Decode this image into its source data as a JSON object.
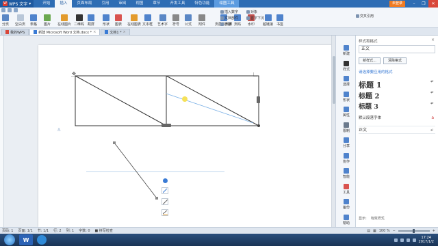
{
  "app": {
    "name": "WPS 文字",
    "login_label": "未登录"
  },
  "menu": [
    {
      "label": "开始",
      "state": "normal"
    },
    {
      "label": "插入",
      "state": "active"
    },
    {
      "label": "页面布局",
      "state": "normal"
    },
    {
      "label": "引用",
      "state": "normal"
    },
    {
      "label": "审阅",
      "state": "normal"
    },
    {
      "label": "视图",
      "state": "normal"
    },
    {
      "label": "章节",
      "state": "normal"
    },
    {
      "label": "开发工具",
      "state": "normal"
    },
    {
      "label": "特色功能",
      "state": "normal"
    },
    {
      "label": "绘图工具",
      "state": "context"
    }
  ],
  "ribbon": {
    "large": [
      {
        "label": "分页",
        "icon": "page-break-icon",
        "color": "#5a87c5"
      },
      {
        "label": "空白页",
        "icon": "blank-page-icon",
        "color": "#b9c7d8"
      },
      {
        "label": "表格",
        "icon": "table-icon",
        "color": "#4f83cc"
      },
      {
        "label": "图片",
        "icon": "picture-icon",
        "color": "#6aa84f"
      },
      {
        "label": "在线图片",
        "icon": "online-picture-icon",
        "color": "#e39b2c"
      },
      {
        "label": "二维码",
        "icon": "qrcode-icon",
        "color": "#333333"
      },
      {
        "label": "截屏",
        "icon": "screenshot-icon",
        "color": "#4f83cc"
      },
      {
        "label": "形状",
        "icon": "shape-icon",
        "color": "#4f83cc"
      },
      {
        "label": "图表",
        "icon": "chart-icon",
        "color": "#d9534f"
      },
      {
        "label": "在线图表",
        "icon": "online-chart-icon",
        "color": "#e39b2c"
      },
      {
        "label": "文本框",
        "icon": "textbox-icon",
        "color": "#4f83cc"
      },
      {
        "label": "艺术字",
        "icon": "wordart-icon",
        "color": "#5a87c5"
      },
      {
        "label": "符号",
        "icon": "symbol-icon",
        "color": "#888888"
      },
      {
        "label": "公式",
        "icon": "formula-icon",
        "color": "#5a87c5"
      },
      {
        "label": "附件",
        "icon": "attachment-icon",
        "color": "#888888"
      },
      {
        "label": "页眉和页脚",
        "icon": "header-footer-icon",
        "color": "#4f83cc"
      },
      {
        "label": "页码",
        "icon": "page-number-icon",
        "color": "#4f83cc"
      },
      {
        "label": "水印",
        "icon": "watermark-icon",
        "color": "#c0504d"
      },
      {
        "label": "超链接",
        "icon": "hyperlink-icon",
        "color": "#4f83cc"
      },
      {
        "label": "书签",
        "icon": "bookmark-icon",
        "color": "#4f83cc"
      }
    ],
    "small": [
      {
        "label": "插入数字",
        "icon": "insert-number-icon"
      },
      {
        "label": "对象",
        "icon": "object-icon"
      },
      {
        "label": "文档部件",
        "icon": "doc-parts-icon"
      },
      {
        "label": "首字下沉",
        "icon": "drop-cap-icon"
      },
      {
        "label": "日期",
        "icon": "date-icon"
      },
      {
        "label": "交叉引用",
        "icon": "cross-reference-icon"
      }
    ]
  },
  "doc_tabs": [
    {
      "label": "我的WPS",
      "active": false
    },
    {
      "label": "新建 Microsoft Word 文档.docx *",
      "active": true
    },
    {
      "label": "文档1 *",
      "active": false
    }
  ],
  "style_pane": {
    "title": "样式和格式",
    "current_style": "正文",
    "new_style_button": "新样式...",
    "clear_format_button": "清除格式",
    "hint": "请选择要应用的格式",
    "items": [
      {
        "label": "标题 1"
      },
      {
        "label": "标题 2"
      },
      {
        "label": "标题 3"
      },
      {
        "label": "默认段落字体"
      },
      {
        "label": "正文"
      }
    ],
    "footer_show_label": "显示:",
    "footer_show_value": "有效样式"
  },
  "side_tools": [
    {
      "label": "新建",
      "icon": "new-icon",
      "color": "#4f83cc"
    },
    {
      "label": "样式",
      "icon": "style-icon",
      "color": "#333333"
    },
    {
      "label": "选择",
      "icon": "select-icon",
      "color": "#4f83cc"
    },
    {
      "label": "形状",
      "icon": "shape-icon",
      "color": "#4f83cc"
    },
    {
      "label": "属性",
      "icon": "property-icon",
      "color": "#4f83cc"
    },
    {
      "label": "限制",
      "icon": "restrict-icon",
      "color": "#6b7a8c"
    },
    {
      "label": "分享",
      "icon": "share-icon",
      "color": "#4f83cc"
    },
    {
      "label": "协作",
      "icon": "collaborate-icon",
      "color": "#4f83cc"
    },
    {
      "label": "智能",
      "icon": "smart-icon",
      "color": "#4f83cc"
    },
    {
      "label": "工具",
      "icon": "tool-icon",
      "color": "#d9534f"
    },
    {
      "label": "备份",
      "icon": "backup-icon",
      "color": "#4f83cc"
    },
    {
      "label": "帮助",
      "icon": "help-icon",
      "color": "#4f83cc"
    }
  ],
  "status": {
    "page_number": "页码: 1",
    "page": "页面: 1/1",
    "section": "节: 1/1",
    "row": "行: 2",
    "column": "列: 1",
    "word_count": "字数: 0",
    "spell_check": "拼写检查",
    "zoom": "100 %",
    "zoom_level": 0.5
  },
  "taskbar": {
    "time": "17:24",
    "date": "2017/1/2"
  },
  "colors": {
    "titlebar": "#2e6db4",
    "accent": "#3a7bd5",
    "highlight": "#f5e15a"
  }
}
